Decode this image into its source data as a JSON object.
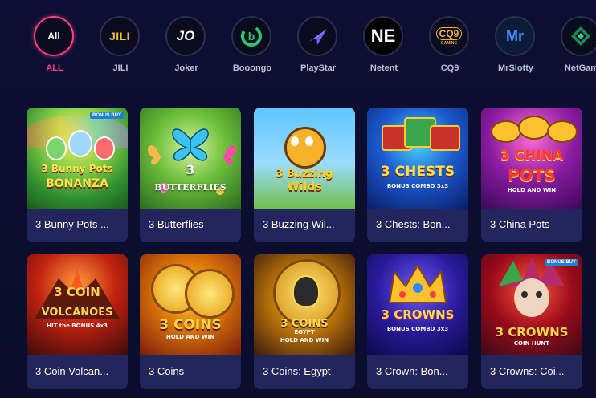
{
  "providers": [
    {
      "label": "ALL",
      "logo": "All"
    },
    {
      "label": "JILI",
      "logo": "JILI"
    },
    {
      "label": "Joker",
      "logo": "JO"
    },
    {
      "label": "Booongo",
      "logo": "b"
    },
    {
      "label": "PlayStar",
      "logo": "plane-icon"
    },
    {
      "label": "Netent",
      "logo": "NE"
    },
    {
      "label": "CQ9",
      "logo": "CQ9",
      "logo_sub": "GAMING"
    },
    {
      "label": "MrSlotty",
      "logo": "Mr"
    },
    {
      "label": "NetGam",
      "logo": "diamond-icon"
    }
  ],
  "games": [
    {
      "title": "3 Bunny Pots ...",
      "art_line1": "3 Bunny Pots",
      "art_line2": "BONANZA",
      "badge": "BONUS BUY"
    },
    {
      "title": "3 Butterflies",
      "art_line1": "3",
      "art_line2": "BUTTERFLIES"
    },
    {
      "title": "3 Buzzing Wil...",
      "art_line1": "3 Buzzing",
      "art_line2": "Wilds"
    },
    {
      "title": "3 Chests: Bon...",
      "art_line1": "3 CHESTS",
      "art_line2": "BONUS COMBO 3x3"
    },
    {
      "title": "3 China Pots",
      "art_line1": "3 CHINA",
      "art_line2": "POTS",
      "art_line3": "HOLD AND WIN"
    },
    {
      "title": "3 Coin Volcan...",
      "art_line1": "3 COIN",
      "art_line2": "VOLCANOES",
      "art_line3": "HIT the BONUS 4x3"
    },
    {
      "title": "3 Coins",
      "art_line1": "3 COINS",
      "art_line2": "HOLD AND WIN"
    },
    {
      "title": "3 Coins: Egypt",
      "art_line1": "3 COINS",
      "art_line2": "EGYPT",
      "art_line3": "HOLD AND WIN"
    },
    {
      "title": "3 Crown: Bon...",
      "art_line1": "3 CROWNS",
      "art_line2": "BONUS COMBO 3x3"
    },
    {
      "title": "3 Crowns: Coi...",
      "art_line1": "3 CROWNS",
      "art_line2": "COIN HUNT",
      "badge": "BONUS BUY"
    }
  ],
  "colors": {
    "accent": "#ff3d8b",
    "card_bg": "#23265c",
    "page_bg": "#0b0e2e"
  }
}
